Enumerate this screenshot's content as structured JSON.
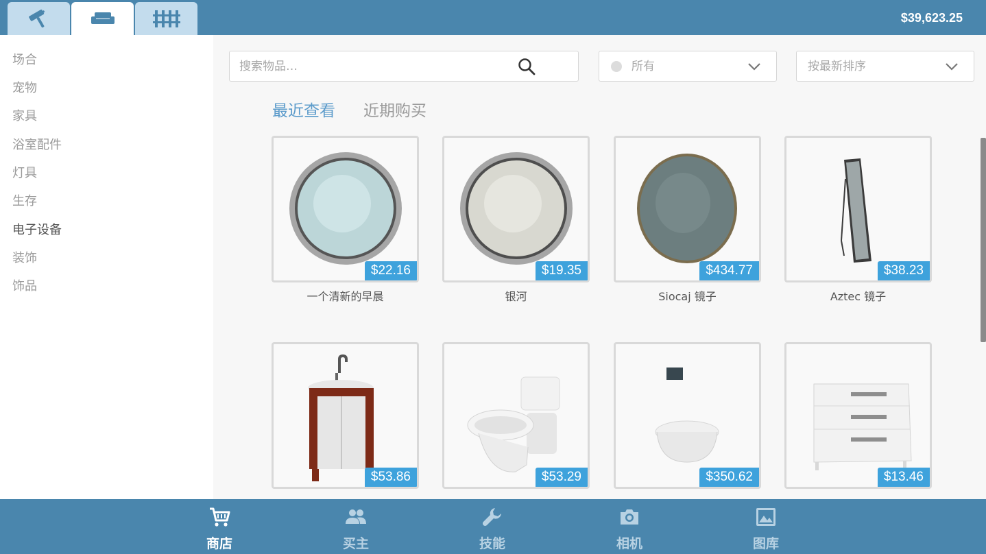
{
  "topbar": {
    "tabs": [
      {
        "icon": "paint-roller-icon"
      },
      {
        "icon": "sofa-icon"
      },
      {
        "icon": "fence-icon"
      }
    ],
    "active_tab": 1,
    "money": "$39,623.25"
  },
  "sidebar": {
    "categories": [
      "场合",
      "宠物",
      "家具",
      "浴室配件",
      "灯具",
      "生存",
      "电子设备",
      "装饰",
      "饰品"
    ],
    "active_category": "电子设备"
  },
  "search": {
    "placeholder": "搜索物品…",
    "value": ""
  },
  "filter": {
    "selected": "所有"
  },
  "sort": {
    "selected": "按最新排序"
  },
  "subtabs": {
    "recent_viewed": "最近查看",
    "recent_bought": "近期购买"
  },
  "items": [
    {
      "name": "一个清新的早晨",
      "price": "$22.16",
      "icon": "round-mirror-icon"
    },
    {
      "name": "银河",
      "price": "$19.35",
      "icon": "round-mirror-icon"
    },
    {
      "name": "Siocaj 镜子",
      "price": "$434.77",
      "icon": "round-mirror-icon"
    },
    {
      "name": "Aztec 镜子",
      "price": "$38.23",
      "icon": "standing-mirror-icon"
    },
    {
      "name": "",
      "price": "$53.86",
      "icon": "vanity-sink-icon"
    },
    {
      "name": "",
      "price": "$53.29",
      "icon": "toilet-icon"
    },
    {
      "name": "",
      "price": "$350.62",
      "icon": "wall-toilet-icon"
    },
    {
      "name": "",
      "price": "$13.46",
      "icon": "drawer-cabinet-icon"
    }
  ],
  "bottom_nav": [
    {
      "label": "商店",
      "icon": "cart-icon",
      "active": true
    },
    {
      "label": "买主",
      "icon": "people-icon",
      "active": false
    },
    {
      "label": "技能",
      "icon": "wrench-icon",
      "active": false
    },
    {
      "label": "相机",
      "icon": "camera-icon",
      "active": false
    },
    {
      "label": "图库",
      "icon": "gallery-icon",
      "active": false
    }
  ],
  "colors": {
    "topbar": "#4a86ad",
    "accent": "#3ea2dc",
    "active_subtab": "#5d9ccb"
  }
}
